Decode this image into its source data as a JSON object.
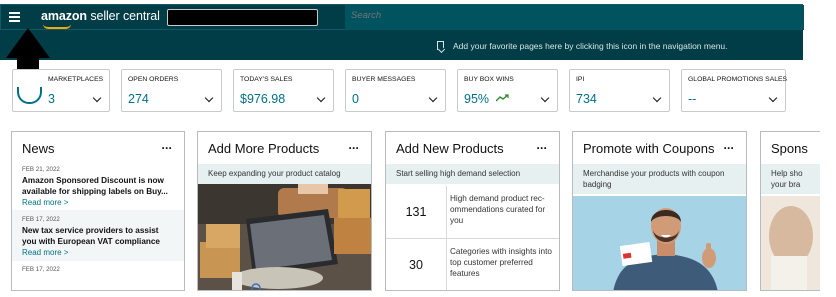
{
  "header": {
    "brand_primary": "amazon",
    "brand_secondary": "seller central",
    "search_placeholder": "Search",
    "favorites_hint": "Add your favorite pages here by clicking this icon in the navigation menu."
  },
  "metrics": [
    {
      "label": "MARKETPLACES",
      "value": "3"
    },
    {
      "label": "OPEN ORDERS",
      "value": "274"
    },
    {
      "label": "TODAY'S SALES",
      "value": "$976.98"
    },
    {
      "label": "BUYER MESSAGES",
      "value": "0"
    },
    {
      "label": "BUY BOX WINS",
      "value": "95%"
    },
    {
      "label": "IPI",
      "value": "734"
    },
    {
      "label": "GLOBAL PROMOTIONS SALES",
      "value": "--"
    }
  ],
  "news": {
    "title": "News",
    "items": [
      {
        "date": "FEB 21, 2022",
        "headline": "Amazon Sponsored Discount is now available for shipping labels on Buy...",
        "link": "Read more >"
      },
      {
        "date": "FEB 17, 2022",
        "headline": "New tax service providers to assist you with European VAT compliance",
        "link": "Read more >"
      },
      {
        "date": "FEB 17, 2022"
      }
    ]
  },
  "add_more": {
    "title": "Add More Products",
    "subtitle": "Keep expanding your product catalog"
  },
  "add_new": {
    "title": "Add New Products",
    "subtitle": "Start selling high demand selection",
    "rows": [
      {
        "count": "131",
        "text": "High demand product rec-ommendations curated for you"
      },
      {
        "count": "30",
        "text": "Categories with insights into top customer preferred features"
      }
    ]
  },
  "coupons": {
    "title": "Promote with Coupons",
    "subtitle": "Merchandise your products with coupon badging"
  },
  "sponsored": {
    "title": "Spons",
    "subtitle": "Help sho your bra"
  },
  "colors": {
    "header_bg": "#003d47",
    "link_teal": "#007185",
    "accent_orange": "#f7a600"
  }
}
